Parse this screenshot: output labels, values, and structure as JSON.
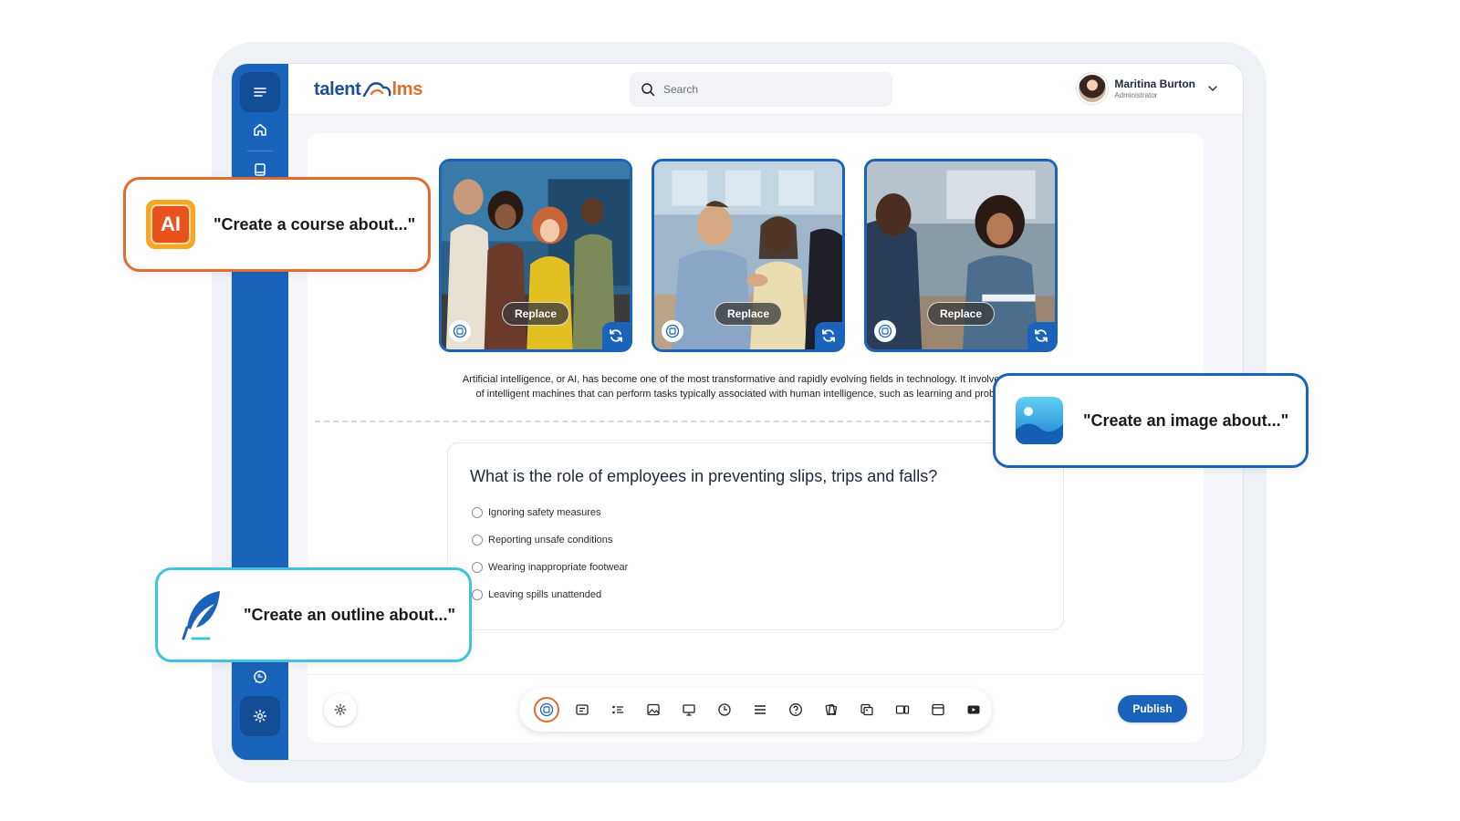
{
  "header": {
    "logo_part1": "talent",
    "logo_part2": "lms",
    "search_placeholder": "Search",
    "user_name": "Maritina Burton",
    "user_role": "Administrator"
  },
  "sidebar": {
    "items": [
      {
        "icon": "menu-icon"
      },
      {
        "icon": "home-icon"
      },
      {
        "icon": "book-icon"
      },
      {
        "icon": "chat-icon"
      },
      {
        "icon": "gear-icon"
      }
    ]
  },
  "images": [
    {
      "replace_label": "Replace"
    },
    {
      "replace_label": "Replace"
    },
    {
      "replace_label": "Replace"
    }
  ],
  "content": {
    "paragraph_line1": "Artificial intelligence, or AI, has become one of the most transformative and rapidly evolving fields in technology. It involves t",
    "paragraph_line2": "of intelligent machines that can perform tasks typically associated with human intelligence, such as learning and probl"
  },
  "quiz": {
    "question": "What is the role of employees in preventing slips, trips and falls?",
    "options": [
      "Ignoring safety measures",
      "Reporting unsafe conditions",
      "Wearing inappropriate footwear",
      "Leaving spills unattended"
    ]
  },
  "toolbar": {
    "icons": [
      "ai-icon",
      "text-icon",
      "list-icon",
      "image-icon",
      "presentation-icon",
      "audio-icon",
      "columns-icon",
      "question-icon",
      "flashcard-icon",
      "gallery-icon",
      "video-icon",
      "window-icon",
      "youtube-icon"
    ],
    "publish_label": "Publish"
  },
  "callouts": {
    "course": "\"Create a course about...\"",
    "image": "\"Create an image about...\"",
    "outline": "\"Create an outline about...\""
  },
  "colors": {
    "brand_blue": "#1a63bb",
    "brand_orange": "#e36b2c",
    "cyan": "#40c2e0"
  }
}
